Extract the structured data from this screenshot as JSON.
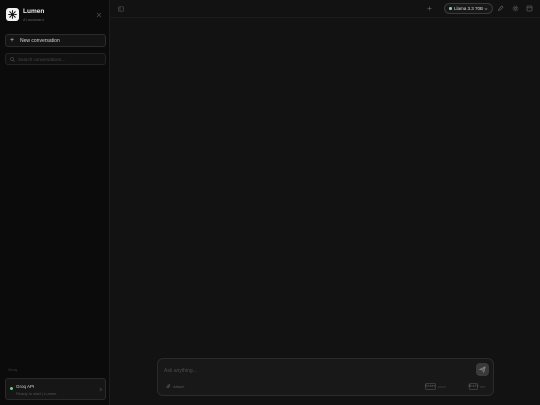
{
  "app": {
    "name": "Lumen",
    "subtitle": "AI assistant"
  },
  "sidebar": {
    "new_conversation_label": "New conversation",
    "search_placeholder": "Search conversations...",
    "footer_label": "Groq",
    "status": {
      "title": "Groq API",
      "subtitle": "Ready to start | Lumen"
    }
  },
  "topbar": {
    "model_label": "Llama 3.3 70B"
  },
  "composer": {
    "placeholder": "Ask anything...",
    "attach_label": "Attach",
    "enter_key": "Enter",
    "enter_label": "send",
    "newline_key": "Shift",
    "newline_label": "line"
  },
  "colors": {
    "background": "#121212",
    "sidebar": "#0b0b0b",
    "status_ok": "#6fd18a"
  }
}
